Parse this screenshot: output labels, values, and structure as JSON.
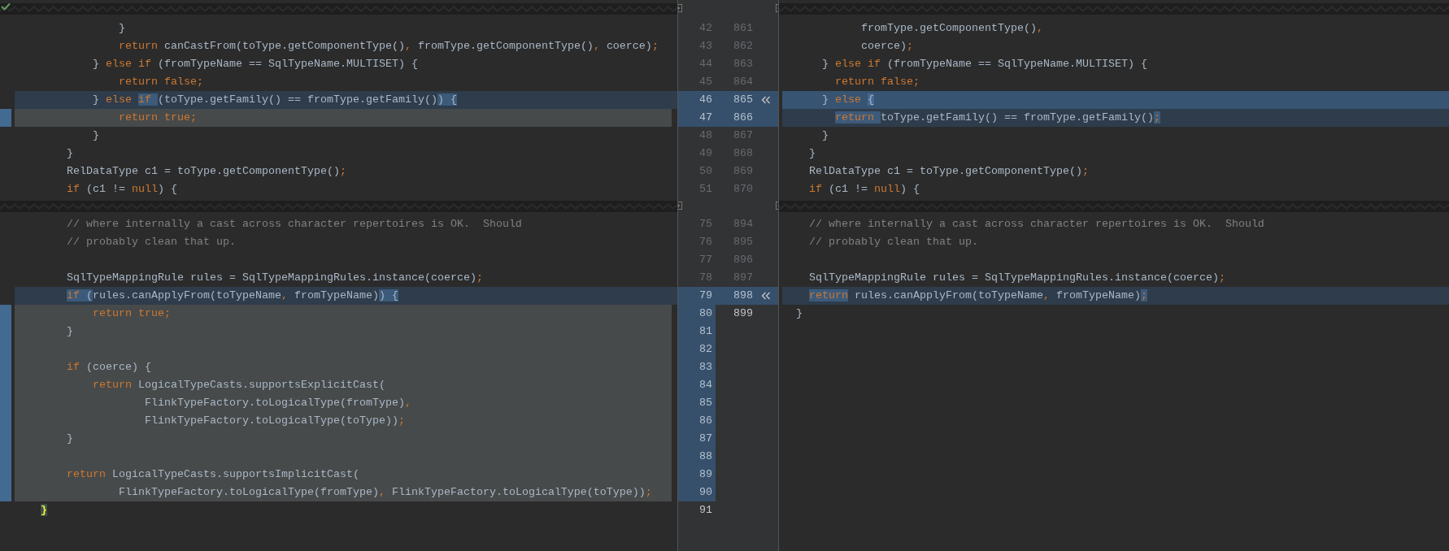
{
  "hunks": [
    {
      "rows": [
        {
          "left": {
            "number": "42",
            "code": [
              {
                "text": "            }"
              }
            ]
          },
          "right": {
            "number": "861",
            "code": [
              {
                "text": "          fromType.getComponentType()"
              },
              {
                "text": ",",
                "kind": "keyword"
              }
            ]
          }
        },
        {
          "left": {
            "number": "43",
            "code": [
              {
                "text": "            return",
                "kind": "keyword"
              },
              {
                "text": " canCastFrom(toType.getComponentType()"
              },
              {
                "text": ",",
                "kind": "keyword"
              },
              {
                "text": " fromType.getComponentType()"
              },
              {
                "text": ",",
                "kind": "keyword"
              },
              {
                "text": " coerce)"
              },
              {
                "text": ";",
                "kind": "keyword"
              }
            ]
          },
          "right": {
            "number": "862",
            "code": [
              {
                "text": "          coerce)"
              },
              {
                "text": ";",
                "kind": "keyword"
              }
            ]
          }
        },
        {
          "left": {
            "number": "44",
            "code": [
              {
                "text": "        } "
              },
              {
                "text": "else if",
                "kind": "keyword"
              },
              {
                "text": " (fromTypeName == SqlTypeName.MULTISET) {"
              }
            ]
          },
          "right": {
            "number": "863",
            "code": [
              {
                "text": "    } "
              },
              {
                "text": "else if",
                "kind": "keyword"
              },
              {
                "text": " (fromTypeName == SqlTypeName.MULTISET) {"
              }
            ]
          }
        },
        {
          "left": {
            "number": "45",
            "code": [
              {
                "text": "            return false;",
                "kind": "keyword"
              }
            ]
          },
          "right": {
            "number": "864",
            "code": [
              {
                "text": "      return false;",
                "kind": "keyword"
              }
            ]
          }
        },
        {
          "apply": true,
          "left": {
            "number": "46",
            "modified": true,
            "code": [
              {
                "text": "        } "
              },
              {
                "text": "else ",
                "kind": "keyword"
              },
              {
                "text": "if ",
                "kind": "keyword",
                "changed": true
              },
              {
                "text": "(toType.getFamily() == fromType.getFamily()"
              },
              {
                "text": ") {",
                "changed": true
              }
            ]
          },
          "right": {
            "number": "865",
            "modified": true,
            "emphasized": true,
            "code": [
              {
                "text": "    } "
              },
              {
                "text": "else ",
                "kind": "keyword"
              },
              {
                "text": "{",
                "changed": true
              }
            ]
          }
        },
        {
          "left": {
            "number": "47",
            "removed": true,
            "code": [
              {
                "text": "            return true;",
                "kind": "keyword"
              }
            ]
          },
          "right": {
            "number": "866",
            "modified": true,
            "code": [
              {
                "text": "      return ",
                "kind": "keyword",
                "changed": true
              },
              {
                "text": "toType.getFamily() == fromType.getFamily()"
              },
              {
                "text": ";",
                "kind": "keyword",
                "changed": true
              }
            ]
          }
        },
        {
          "left": {
            "number": "48",
            "code": [
              {
                "text": "        }"
              }
            ]
          },
          "right": {
            "number": "867",
            "code": [
              {
                "text": "    }"
              }
            ]
          }
        },
        {
          "left": {
            "number": "49",
            "code": [
              {
                "text": "    }"
              }
            ]
          },
          "right": {
            "number": "868",
            "code": [
              {
                "text": "  }"
              }
            ]
          }
        },
        {
          "left": {
            "number": "50",
            "code": [
              {
                "text": "    RelDataType c1 = toType.getComponentType()"
              },
              {
                "text": ";",
                "kind": "keyword"
              }
            ]
          },
          "right": {
            "number": "869",
            "code": [
              {
                "text": "  RelDataType c1 = toType.getComponentType()"
              },
              {
                "text": ";",
                "kind": "keyword"
              }
            ]
          }
        },
        {
          "left": {
            "number": "51",
            "code": [
              {
                "text": "    if",
                "kind": "keyword"
              },
              {
                "text": " (c1 != "
              },
              {
                "text": "null",
                "kind": "keyword"
              },
              {
                "text": ") {"
              }
            ]
          },
          "right": {
            "number": "870",
            "code": [
              {
                "text": "  if",
                "kind": "keyword"
              },
              {
                "text": " (c1 != "
              },
              {
                "text": "null",
                "kind": "keyword"
              },
              {
                "text": ") {"
              }
            ]
          }
        }
      ]
    },
    {
      "rows": [
        {
          "left": {
            "number": "75",
            "code": [
              {
                "text": "    // where internally a cast across character repertoires is OK.  Should",
                "kind": "comment"
              }
            ]
          },
          "right": {
            "number": "894",
            "code": [
              {
                "text": "  // where internally a cast across character repertoires is OK.  Should",
                "kind": "comment"
              }
            ]
          }
        },
        {
          "left": {
            "number": "76",
            "code": [
              {
                "text": "    // probably clean that up.",
                "kind": "comment"
              }
            ]
          },
          "right": {
            "number": "895",
            "code": [
              {
                "text": "  // probably clean that up.",
                "kind": "comment"
              }
            ]
          }
        },
        {
          "left": {
            "number": "77"
          },
          "right": {
            "number": "896"
          }
        },
        {
          "left": {
            "number": "78",
            "code": [
              {
                "text": "    SqlTypeMappingRule rules = SqlTypeMappingRules.instance(coerce)"
              },
              {
                "text": ";",
                "kind": "keyword"
              }
            ]
          },
          "right": {
            "number": "897",
            "code": [
              {
                "text": "  SqlTypeMappingRule rules = SqlTypeMappingRules.instance(coerce)"
              },
              {
                "text": ";",
                "kind": "keyword"
              }
            ]
          }
        },
        {
          "apply": true,
          "left": {
            "number": "79",
            "modified": true,
            "code": [
              {
                "text": "    if ",
                "kind": "keyword",
                "changed": true
              },
              {
                "text": "(",
                "changed": true
              },
              {
                "text": "rules.canApplyFrom(toTypeName"
              },
              {
                "text": ",",
                "kind": "keyword"
              },
              {
                "text": " fromTypeName)"
              },
              {
                "text": ") {",
                "changed": true
              }
            ]
          },
          "right": {
            "number": "898",
            "modified": true,
            "code": [
              {
                "text": "  return",
                "kind": "keyword",
                "changed": true
              },
              {
                "text": " rules.canApplyFrom(toTypeName"
              },
              {
                "text": ",",
                "kind": "keyword"
              },
              {
                "text": " fromTypeName)"
              },
              {
                "text": ";",
                "kind": "keyword",
                "changed": true
              }
            ]
          }
        },
        {
          "left": {
            "number": "80",
            "removed": true,
            "code": [
              {
                "text": "        return true;",
                "kind": "keyword"
              }
            ]
          },
          "right": {
            "number": "899",
            "current": true,
            "code": [
              {
                "text": "}"
              }
            ]
          }
        },
        {
          "left": {
            "number": "81",
            "removed": true,
            "code": [
              {
                "text": "    }"
              }
            ]
          }
        },
        {
          "left": {
            "number": "82",
            "removed": true
          }
        },
        {
          "left": {
            "number": "83",
            "removed": true,
            "code": [
              {
                "text": "    if",
                "kind": "keyword"
              },
              {
                "text": " (coerce) {"
              }
            ]
          }
        },
        {
          "left": {
            "number": "84",
            "removed": true,
            "code": [
              {
                "text": "        return",
                "kind": "keyword"
              },
              {
                "text": " LogicalTypeCasts.supportsExplicitCast("
              }
            ]
          }
        },
        {
          "left": {
            "number": "85",
            "removed": true,
            "code": [
              {
                "text": "                FlinkTypeFactory.toLogicalType(fromType)"
              },
              {
                "text": ",",
                "kind": "keyword"
              }
            ]
          }
        },
        {
          "left": {
            "number": "86",
            "removed": true,
            "code": [
              {
                "text": "                FlinkTypeFactory.toLogicalType(toType))"
              },
              {
                "text": ";",
                "kind": "keyword"
              }
            ]
          }
        },
        {
          "left": {
            "number": "87",
            "removed": true,
            "code": [
              {
                "text": "    }"
              }
            ]
          }
        },
        {
          "left": {
            "number": "88",
            "removed": true
          }
        },
        {
          "left": {
            "number": "89",
            "removed": true,
            "code": [
              {
                "text": "    return",
                "kind": "keyword"
              },
              {
                "text": " LogicalTypeCasts.supportsImplicitCast("
              }
            ]
          }
        },
        {
          "left": {
            "number": "90",
            "removed": true,
            "code": [
              {
                "text": "            FlinkTypeFactory.toLogicalType(fromType)"
              },
              {
                "text": ",",
                "kind": "keyword"
              },
              {
                "text": " FlinkTypeFactory.toLogicalType(toType))"
              },
              {
                "text": ";",
                "kind": "keyword"
              }
            ]
          }
        },
        {
          "left": {
            "number": "91",
            "current": true,
            "code": [
              {
                "text": "}",
                "kind": "brace-match"
              }
            ]
          }
        }
      ]
    }
  ]
}
